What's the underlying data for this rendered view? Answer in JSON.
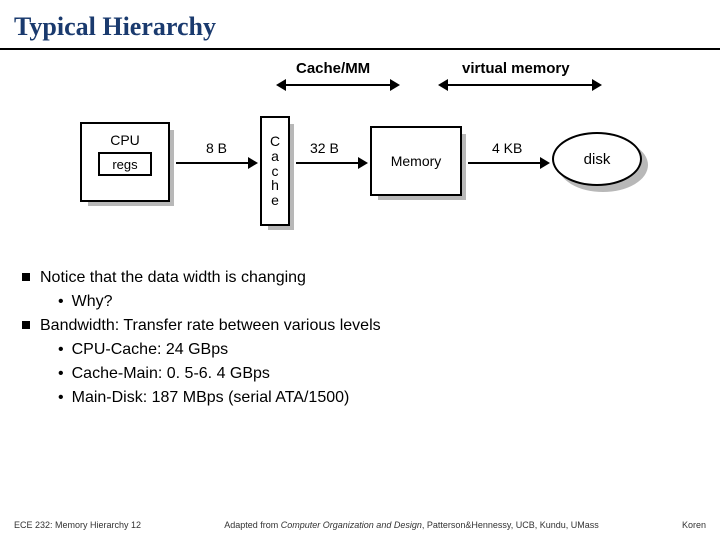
{
  "title": "Typical Hierarchy",
  "top": {
    "cache_mm": "Cache/MM",
    "virtual_memory": "virtual memory"
  },
  "boxes": {
    "cpu": "CPU",
    "regs": "regs",
    "cache_vertical": "C\na\nc\nh\ne",
    "memory": "Memory",
    "disk": "disk"
  },
  "links": {
    "cpu_cache": "8 B",
    "cache_mem": "32 B",
    "mem_disk": "4 KB"
  },
  "bullets": {
    "notice": "Notice that the data width is changing",
    "why": "Why?",
    "bandwidth": "Bandwidth: Transfer rate between various levels",
    "cpu_cache": "CPU-Cache: 24 GBps",
    "cache_main": "Cache-Main: 0. 5-6. 4 GBps",
    "main_disk": "Main-Disk: 187 MBps (serial ATA/1500)"
  },
  "footer": {
    "left": "ECE 232: Memory Hierarchy 12",
    "center_prefix": "Adapted from ",
    "center_italic": "Computer Organization and Design",
    "center_suffix": ", Patterson&Hennessy, UCB, Kundu, UMass",
    "right": "Koren"
  }
}
